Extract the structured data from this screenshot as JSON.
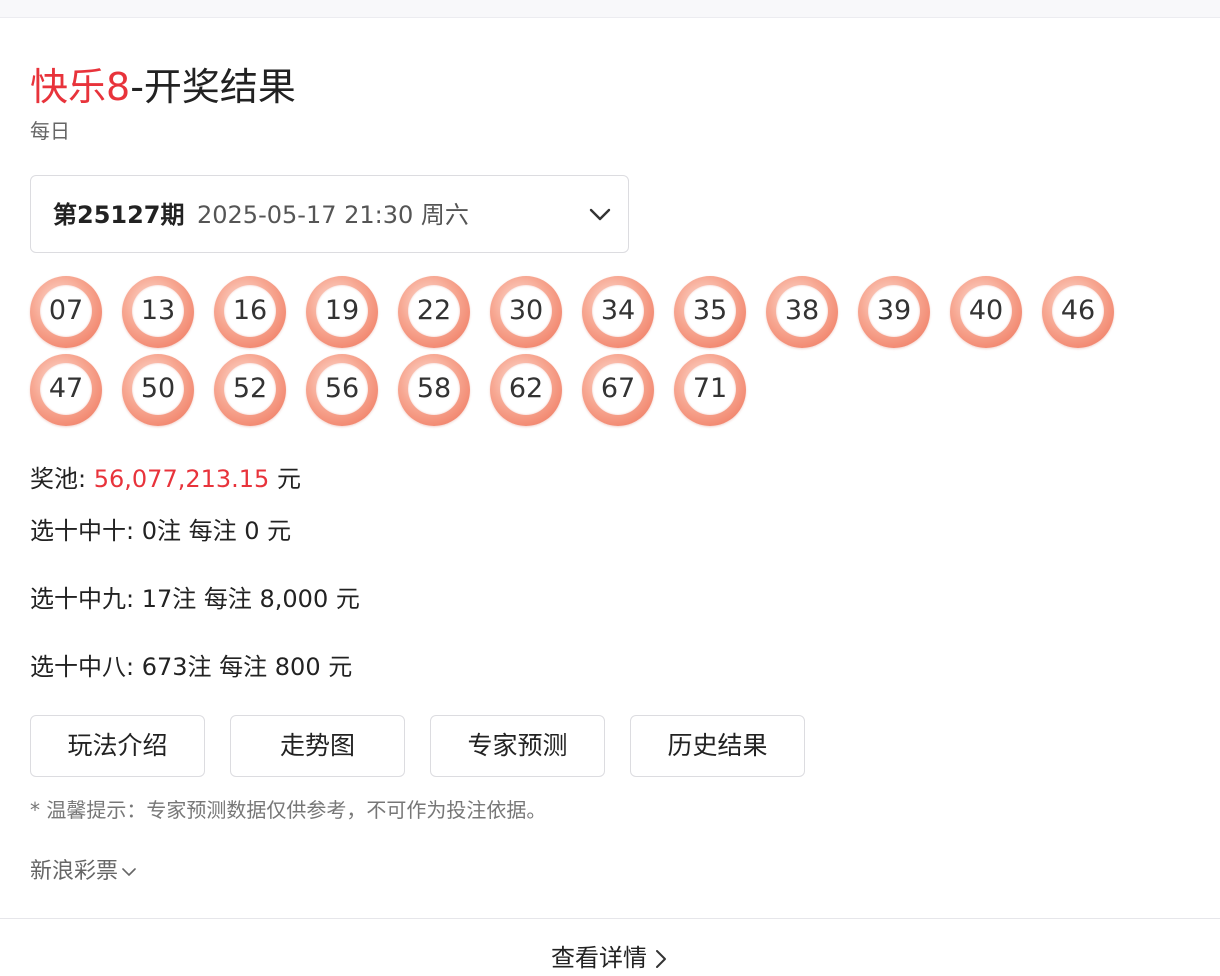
{
  "header": {
    "brand": "快乐8",
    "title_rest": "-开奖结果",
    "subtitle": "每日"
  },
  "issue": {
    "number": "第25127期",
    "datetime": "2025-05-17 21:30 周六",
    "dropdown_icon": "chevron-down-icon"
  },
  "numbers": [
    "07",
    "13",
    "16",
    "19",
    "22",
    "30",
    "34",
    "35",
    "38",
    "39",
    "40",
    "46",
    "47",
    "50",
    "52",
    "56",
    "58",
    "62",
    "67",
    "71"
  ],
  "pool": {
    "label": "奖池:",
    "value": "56,077,213.15",
    "unit": "元"
  },
  "prizes": [
    {
      "text": "选十中十: 0注 每注 0 元"
    },
    {
      "text": "选十中九: 17注 每注 8,000 元"
    },
    {
      "text": "选十中八: 673注 每注 800 元"
    }
  ],
  "buttons": {
    "rules": "玩法介绍",
    "trend": "走势图",
    "expert": "专家预测",
    "history": "历史结果"
  },
  "tip": "* 温馨提示：专家预测数据仅供参考，不可作为投注依据。",
  "source": "新浪彩票",
  "more": "查看详情",
  "colors": {
    "brand": "#e8333b",
    "ball_ring": "#ee6f55"
  }
}
